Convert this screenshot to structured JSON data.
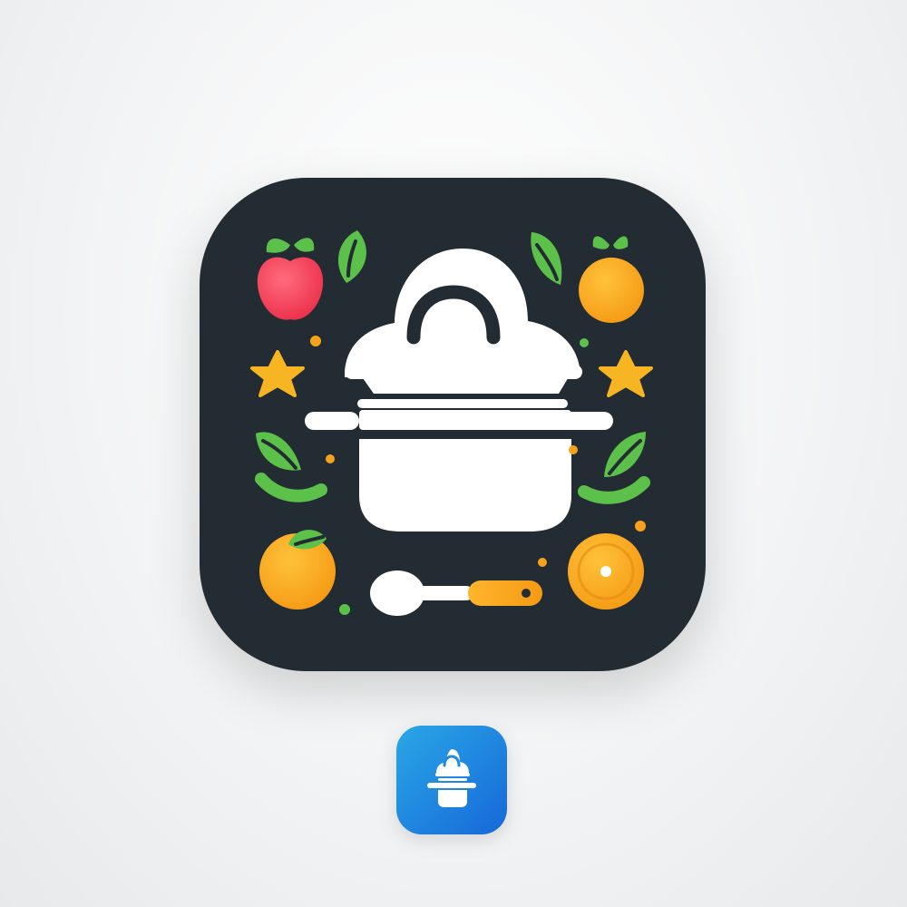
{
  "icons": {
    "large": {
      "name": "cooking-pot-app-icon",
      "background": "#242c33",
      "glyph": "#ffffff",
      "decorations": [
        "apple-icon",
        "orange-icon",
        "leaf-icon",
        "star-icon",
        "dot-icon",
        "spoon-icon",
        "plate-icon"
      ]
    },
    "small": {
      "name": "cooking-pot-app-icon-small",
      "gradient_start": "#2aa7e6",
      "gradient_end": "#1668d9",
      "glyph": "#ffffff"
    }
  },
  "colors": {
    "apple": "#f5445b",
    "orange": "#f7a21d",
    "green": "#5cc14a",
    "star": "#f7b523"
  }
}
